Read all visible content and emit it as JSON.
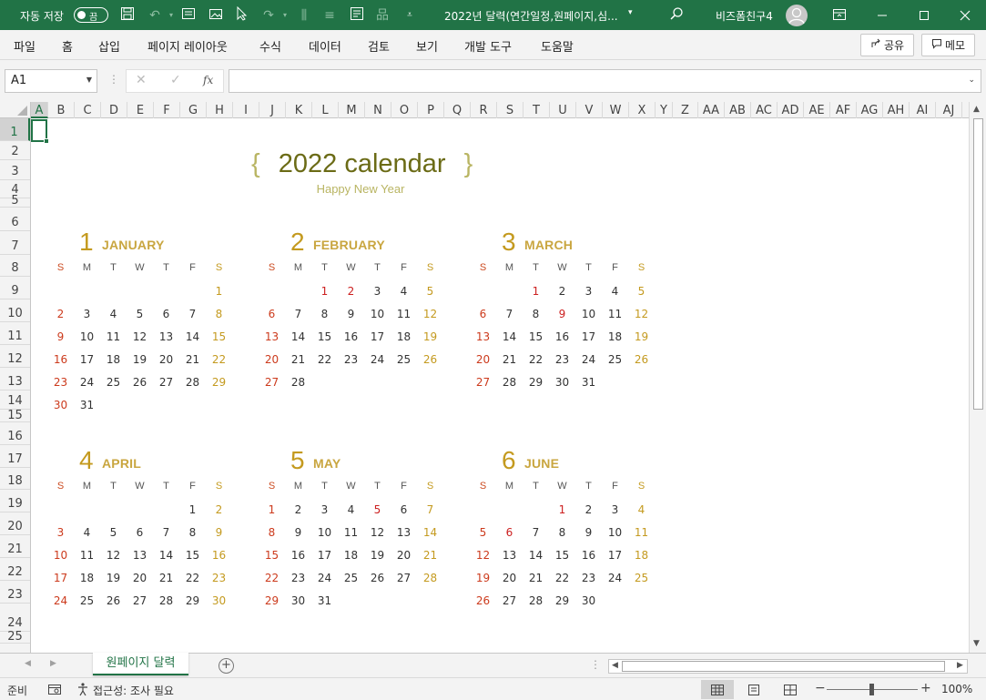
{
  "titlebar": {
    "autosave_label": "자동 저장",
    "autosave_state": "끔",
    "doc_title": "2022년 달력(연간일정,원페이지,심...",
    "user_name": "비즈폼친구4"
  },
  "menu": {
    "items": [
      "파일",
      "홈",
      "삽입",
      "페이지 레이아웃",
      "수식",
      "데이터",
      "검토",
      "보기",
      "개발 도구",
      "도움말"
    ],
    "share_label": "공유",
    "memo_label": "메모"
  },
  "formula_bar": {
    "name_box": "A1",
    "fx_label": "fx",
    "formula": ""
  },
  "grid": {
    "columns": [
      "A",
      "B",
      "C",
      "D",
      "E",
      "F",
      "G",
      "H",
      "I",
      "J",
      "K",
      "L",
      "M",
      "N",
      "O",
      "P",
      "Q",
      "R",
      "S",
      "T",
      "U",
      "V",
      "W",
      "X",
      "Y",
      "Z",
      "AA",
      "AB",
      "AC",
      "AD",
      "AE",
      "AF",
      "AG",
      "AH",
      "AI",
      "AJ"
    ],
    "rows": [
      "1",
      "2",
      "3",
      "4",
      "5",
      "6",
      "7",
      "8",
      "9",
      "10",
      "11",
      "12",
      "13",
      "14",
      "15",
      "16",
      "17",
      "18",
      "19",
      "20",
      "21",
      "22",
      "23",
      "24",
      "25"
    ],
    "selected_column": "A",
    "selected_row": "1"
  },
  "calendar": {
    "title": "2022 calendar",
    "brace_open": "{",
    "brace_close": "}",
    "subtitle": "Happy New Year",
    "weekdays": [
      "S",
      "M",
      "T",
      "W",
      "T",
      "F",
      "S"
    ],
    "months": [
      {
        "num": "1",
        "name": "JANUARY",
        "first_dow": 6,
        "days": 31,
        "holidays": []
      },
      {
        "num": "2",
        "name": "FEBRUARY",
        "first_dow": 2,
        "days": 28,
        "holidays": [
          1,
          2
        ]
      },
      {
        "num": "3",
        "name": "MARCH",
        "first_dow": 2,
        "days": 31,
        "holidays": [
          1,
          9
        ]
      },
      {
        "num": "4",
        "name": "APRIL",
        "first_dow": 5,
        "days": 30,
        "holidays": []
      },
      {
        "num": "5",
        "name": "MAY",
        "first_dow": 0,
        "days": 31,
        "holidays": [
          5
        ]
      },
      {
        "num": "6",
        "name": "JUNE",
        "first_dow": 3,
        "days": 30,
        "holidays": [
          1,
          6
        ]
      }
    ]
  },
  "sheet_tabs": {
    "active_tab": "원페이지 달력",
    "add_label": "+"
  },
  "statusbar": {
    "ready": "준비",
    "accessibility": "접근성: 조사 필요",
    "zoom": "100%"
  }
}
